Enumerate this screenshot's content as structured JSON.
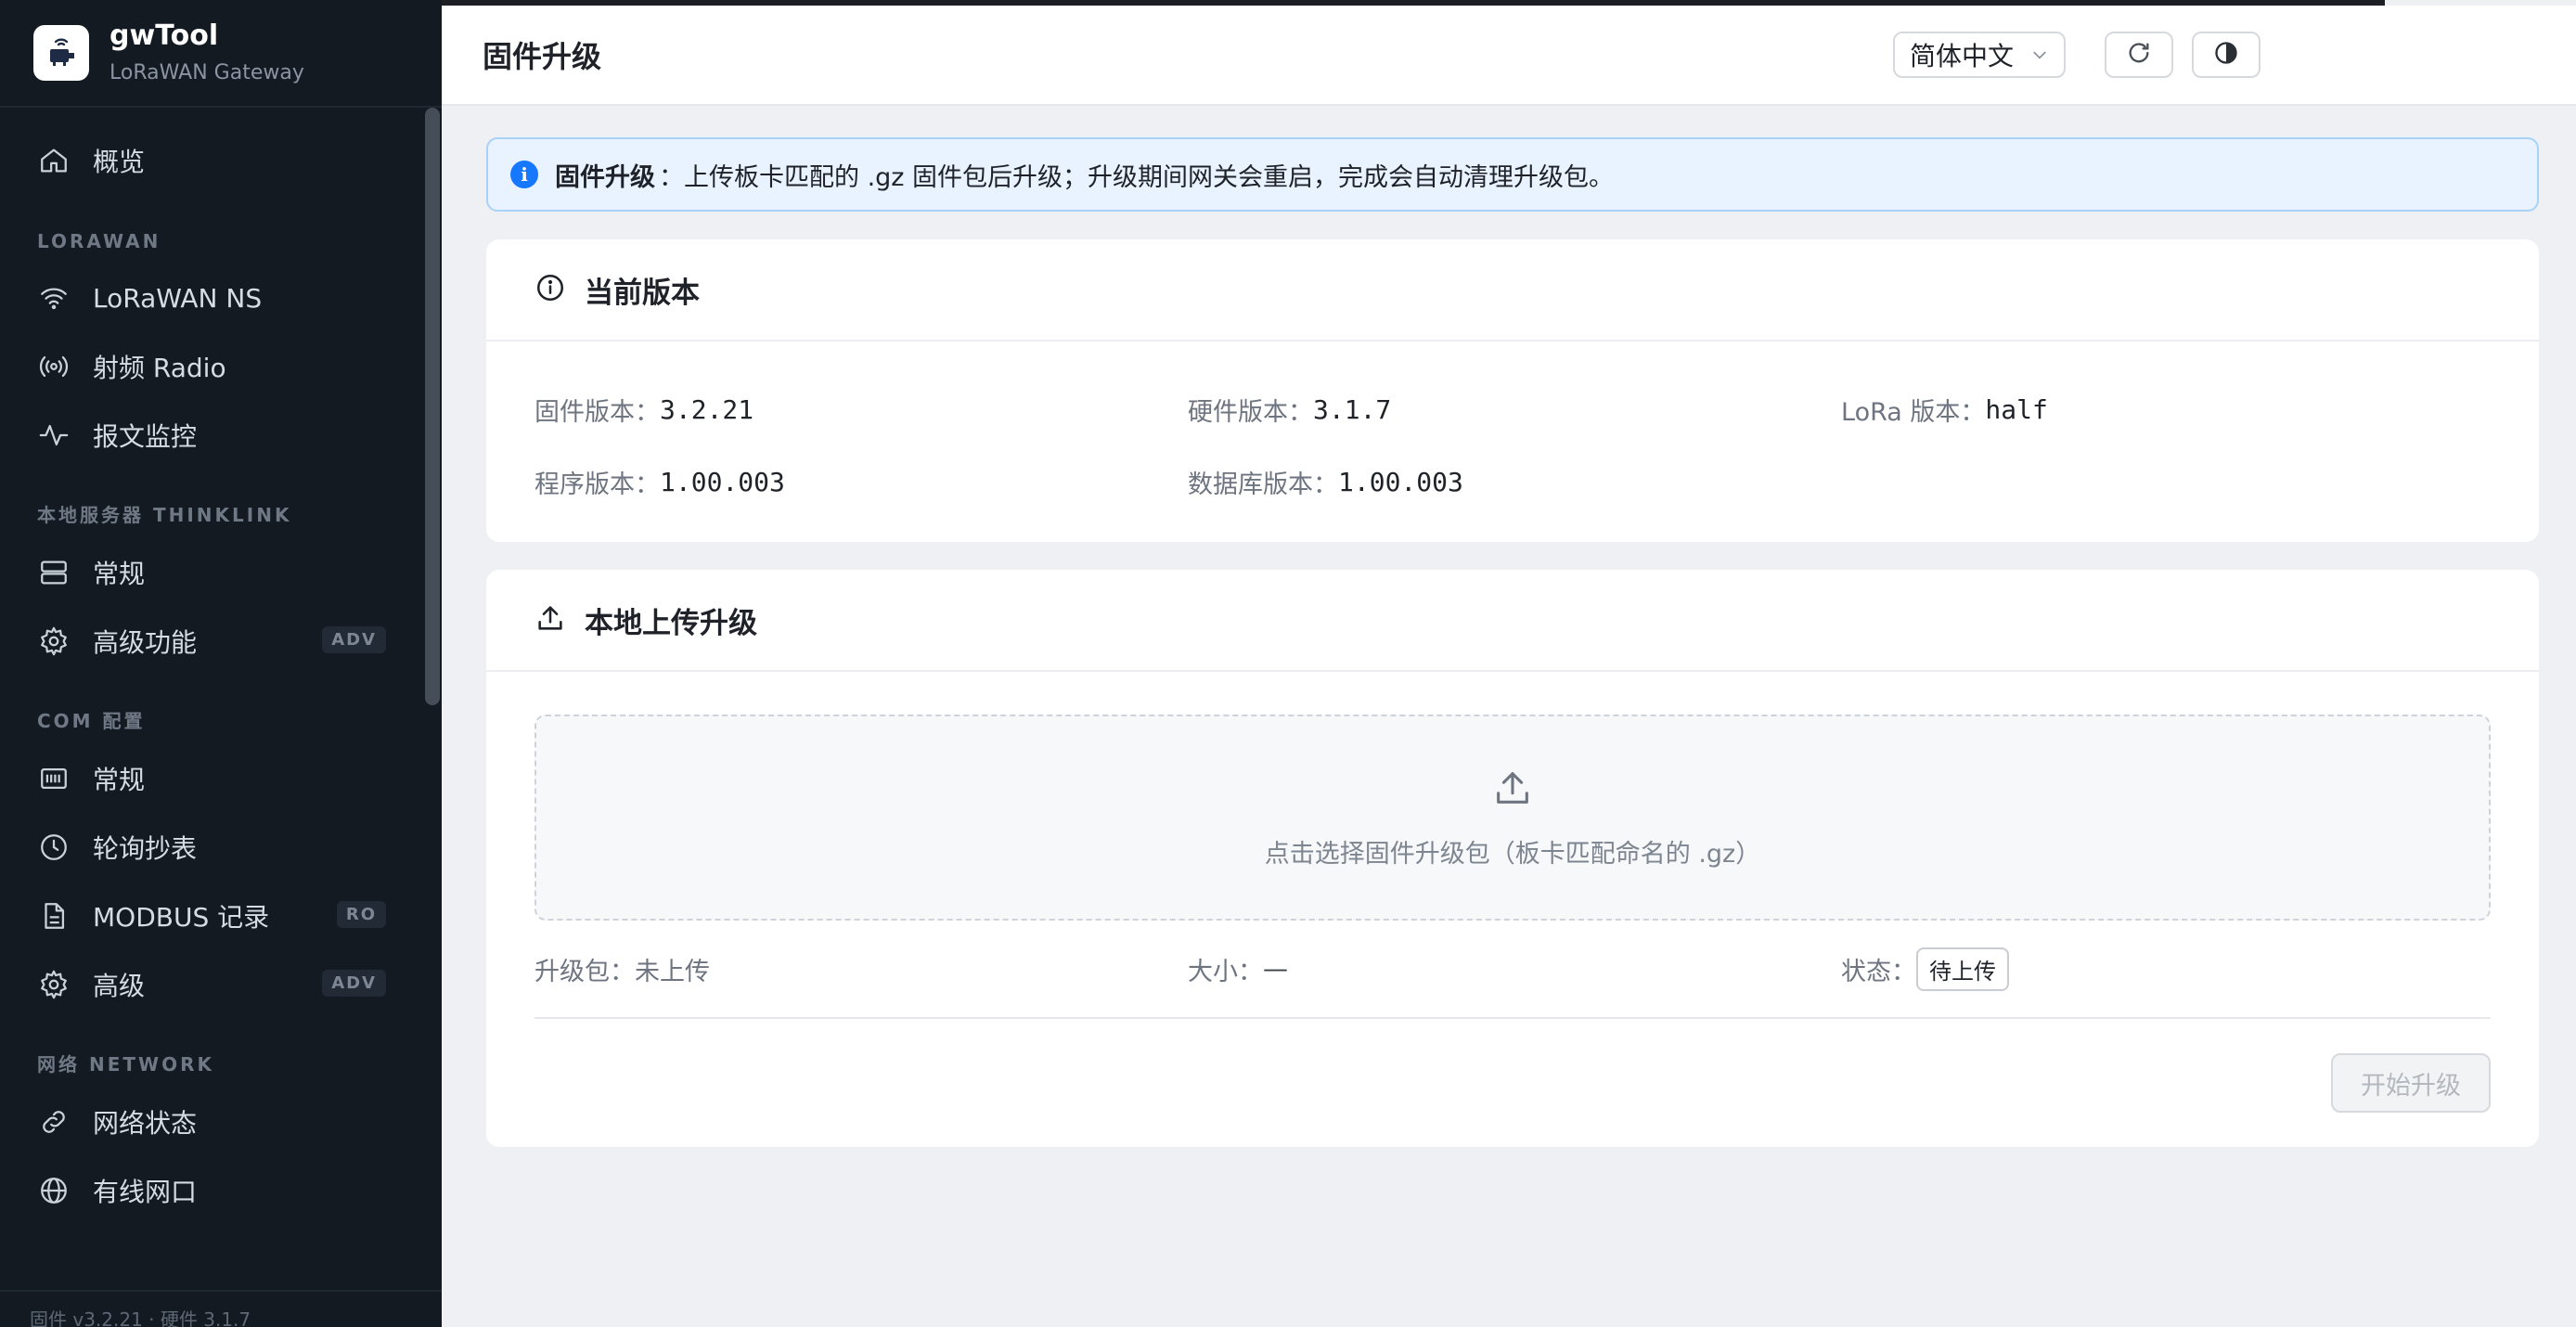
{
  "app": {
    "name": "gwTool",
    "subtitle": "LoRaWAN Gateway"
  },
  "sidebar": {
    "items": [
      {
        "label": "概览",
        "icon": "home-icon"
      },
      {
        "section": "LORAWAN"
      },
      {
        "label": "LoRaWAN NS",
        "icon": "wifi-icon"
      },
      {
        "label": "射频 Radio",
        "icon": "radio-icon"
      },
      {
        "label": "报文监控",
        "icon": "activity-icon"
      },
      {
        "section": "本地服务器 THINKLINK"
      },
      {
        "label": "常规",
        "icon": "server-icon"
      },
      {
        "label": "高级功能",
        "icon": "gear-icon",
        "badge": "ADV"
      },
      {
        "section": "COM 配置"
      },
      {
        "label": "常规",
        "icon": "barcode-icon"
      },
      {
        "label": "轮询抄表",
        "icon": "clock-icon"
      },
      {
        "label": "MODBUS 记录",
        "icon": "document-icon",
        "badge": "RO"
      },
      {
        "label": "高级",
        "icon": "gear-icon",
        "badge": "ADV"
      },
      {
        "section": "网络 NETWORK"
      },
      {
        "label": "网络状态",
        "icon": "link-icon"
      },
      {
        "label": "有线网口",
        "icon": "globe-icon"
      }
    ],
    "footer": "固件 v3.2.21 · 硬件 3.1.7"
  },
  "header": {
    "title": "固件升级",
    "language": "简体中文"
  },
  "alert": {
    "strong": "固件升级",
    "text": "：上传板卡匹配的 .gz 固件包后升级；升级期间网关会重启，完成会自动清理升级包。"
  },
  "version_card": {
    "title": "当前版本",
    "fields": [
      {
        "label": "固件版本：",
        "value": "3.2.21"
      },
      {
        "label": "硬件版本：",
        "value": "3.1.7"
      },
      {
        "label": "LoRa 版本：",
        "value": "half"
      },
      {
        "label": "程序版本：",
        "value": "1.00.003"
      },
      {
        "label": "数据库版本：",
        "value": "1.00.003"
      }
    ]
  },
  "upload_card": {
    "title": "本地上传升级",
    "dropzone_text": "点击选择固件升级包（板卡匹配命名的 .gz）",
    "package_label": "升级包：",
    "package_value": "未上传",
    "size_label": "大小：",
    "size_value": "—",
    "status_label": "状态：",
    "status_value": "待上传",
    "start_button": "开始升级"
  },
  "colors": {
    "sidebar_bg": "#141a22",
    "accent": "#1677ff",
    "alert_bg": "#e8f3ff"
  }
}
